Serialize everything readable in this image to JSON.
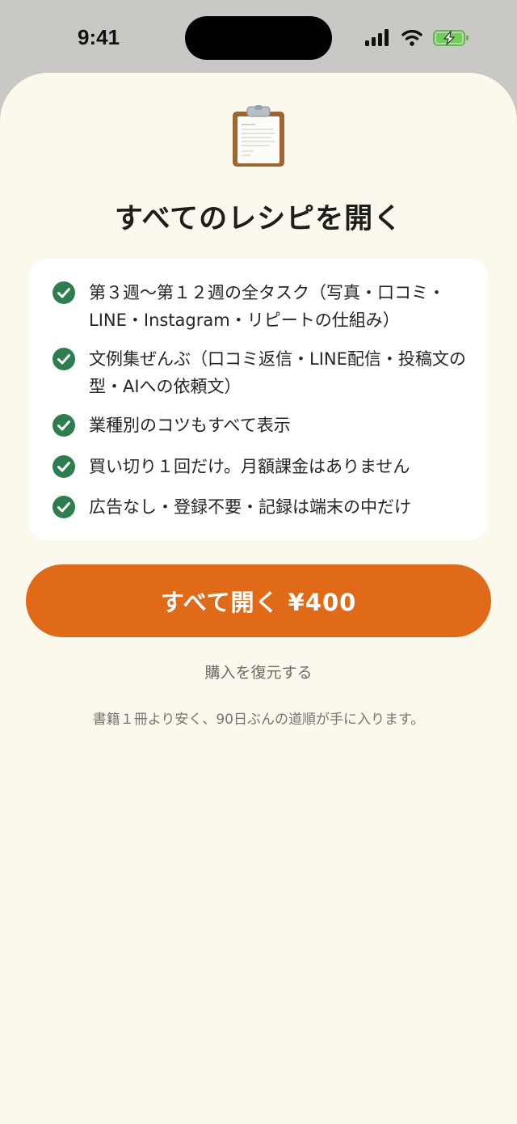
{
  "status_bar": {
    "time": "9:41"
  },
  "header": {
    "icon": "clipboard-icon",
    "title": "すべてのレシピを開く"
  },
  "features": [
    {
      "icon": "check-circle-icon",
      "text": "第３週〜第１２週の全タスク（写真・口コミ・LINE・Instagram・リピートの仕組み）"
    },
    {
      "icon": "check-circle-icon",
      "text": "文例集ぜんぶ（口コミ返信・LINE配信・投稿文の型・AIへの依頼文）"
    },
    {
      "icon": "check-circle-icon",
      "text": "業種別のコツもすべて表示"
    },
    {
      "icon": "check-circle-icon",
      "text": "買い切り１回だけ。月額課金はありません"
    },
    {
      "icon": "check-circle-icon",
      "text": "広告なし・登録不要・記録は端末の中だけ"
    }
  ],
  "purchase": {
    "button_label": "すべて開く ¥400",
    "restore_label": "購入を復元する",
    "note": "書籍１冊より安く、90日ぶんの道順が手に入ります。"
  },
  "colors": {
    "accent": "#e06a17",
    "check": "#2e7d4f",
    "sheet_background": "#fbf8ee",
    "card_background": "#ffffff"
  }
}
